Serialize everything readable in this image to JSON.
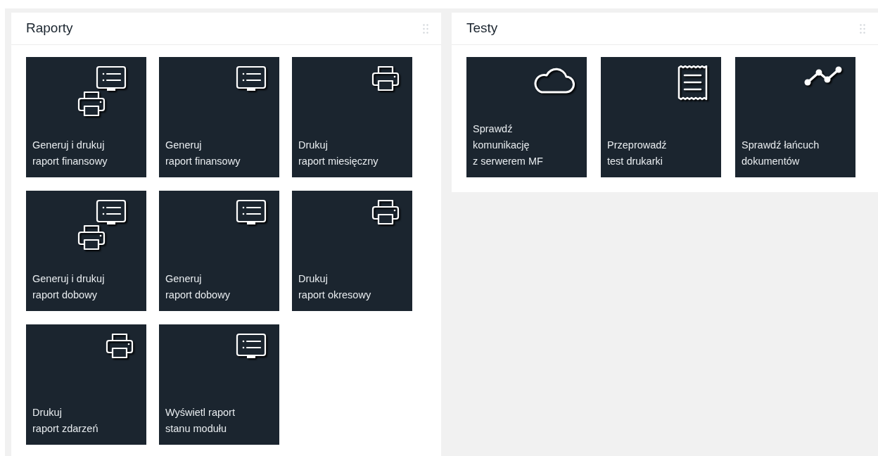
{
  "panels": [
    {
      "title": "Raporty",
      "tiles": [
        {
          "kind": "printer-monitor",
          "lines": [
            "Generuj i drukuj",
            "raport finansowy"
          ]
        },
        {
          "kind": "monitor",
          "lines": [
            "Generuj",
            "raport finansowy"
          ]
        },
        {
          "kind": "printer",
          "lines": [
            "Drukuj",
            "raport miesięczny"
          ]
        },
        {
          "kind": "printer-monitor",
          "lines": [
            "Generuj i drukuj",
            "raport dobowy"
          ]
        },
        {
          "kind": "monitor",
          "lines": [
            "Generuj",
            "raport dobowy"
          ]
        },
        {
          "kind": "printer",
          "lines": [
            "Drukuj",
            "raport okresowy"
          ]
        },
        {
          "kind": "printer",
          "lines": [
            "Drukuj",
            "raport zdarzeń"
          ]
        },
        {
          "kind": "monitor",
          "lines": [
            "Wyświetl raport",
            "stanu modułu"
          ]
        }
      ]
    },
    {
      "title": "Testy",
      "tiles": [
        {
          "kind": "cloud",
          "lines": [
            "Sprawdź",
            "komunikację",
            "z serwerem MF"
          ]
        },
        {
          "kind": "receipt",
          "lines": [
            "Przeprowadź",
            "test drukarki"
          ]
        },
        {
          "kind": "chart",
          "lines": [
            "Sprawdź łańcuch",
            "dokumentów"
          ]
        }
      ]
    }
  ]
}
